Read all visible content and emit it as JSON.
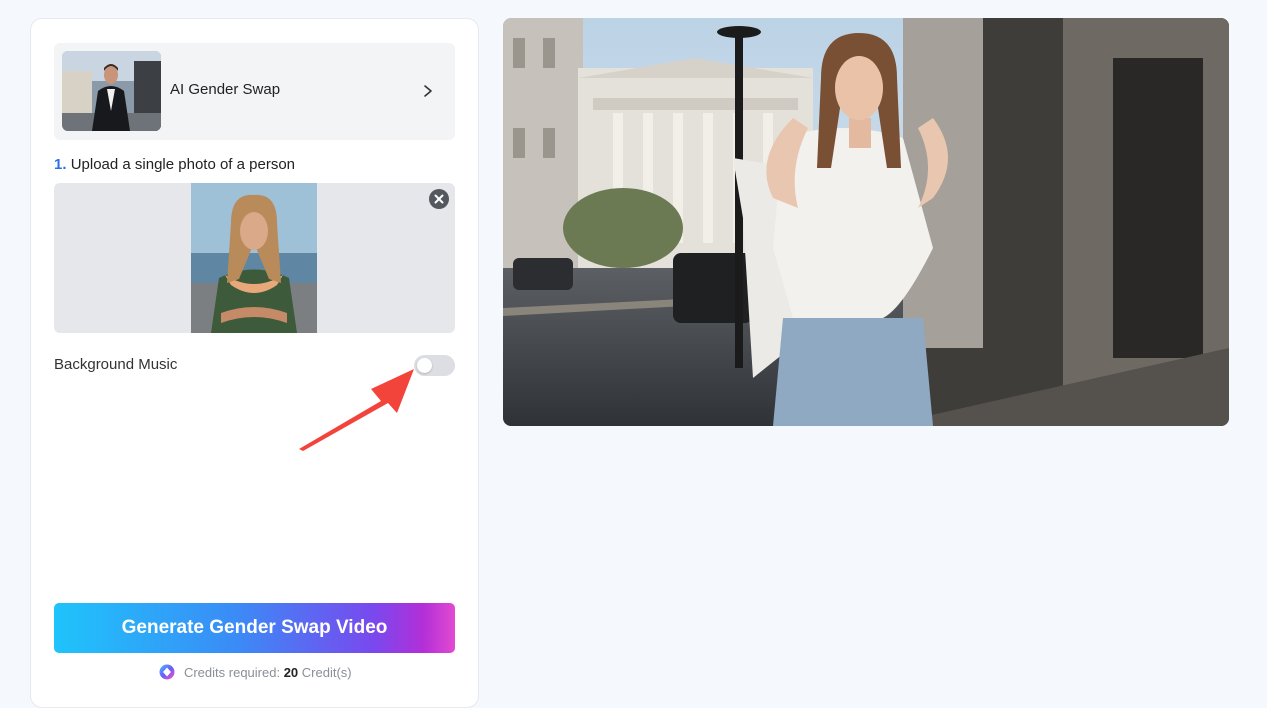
{
  "tool_card": {
    "title": "AI Gender Swap"
  },
  "upload": {
    "step_number": "1.",
    "step_text": "Upload a single photo of a person"
  },
  "settings": {
    "background_music_label": "Background Music",
    "background_music_enabled": false
  },
  "generate": {
    "button_label": "Generate Gender Swap Video",
    "credits_prefix": "Credits required:",
    "credits_value": "20",
    "credits_suffix": "Credit(s)"
  },
  "icons": {
    "chevron": "chevron-right-icon",
    "remove": "close-icon",
    "credit": "credit-gem-icon",
    "annotation": "red-arrow-annotation"
  },
  "colors": {
    "accent": "#2f6fe4",
    "arrow": "#f2443b",
    "gradient_start": "#1fc4fb",
    "gradient_end": "#e24ad1"
  }
}
